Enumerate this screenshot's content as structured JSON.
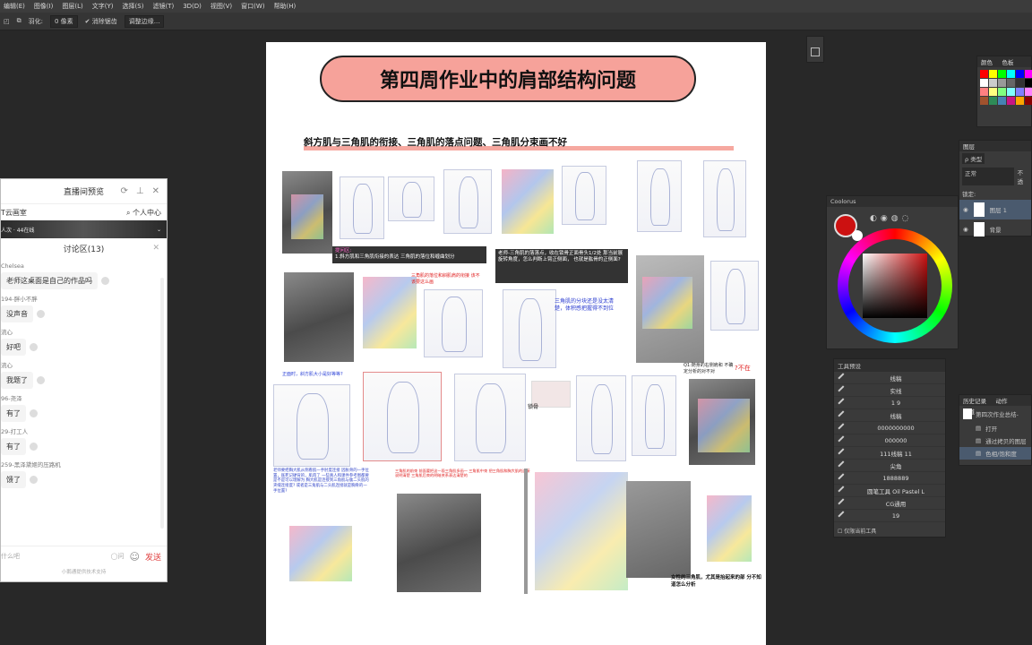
{
  "menu": [
    "编辑(E)",
    "图像(I)",
    "图层(L)",
    "文字(Y)",
    "选择(S)",
    "滤镜(T)",
    "3D(D)",
    "视图(V)",
    "窗口(W)",
    "帮助(H)"
  ],
  "options": {
    "feather_label": "羽化:",
    "feather_value": "0 像素",
    "antialias": "消除锯齿",
    "refine": "调整边缘..."
  },
  "document": {
    "title": "第四周作业中的肩部结构问题",
    "subtitle": "斜方肌与三角肌的衔接、三角肌的落点问题、三角肌分束画不好",
    "caption1": "1.斜方肌和三角肌衔接的表达 三角肌的落位和缠曲划分",
    "caption1_head": "提问区:",
    "caption2": "老师-三角肌的落落点，收在锁骨正面骨头1/2处 那当前展旋转角度，怎么判断上臂正侧面， 也就是肱骨的正侧面?",
    "blue_note": "三角肌的分块还是没太清楚，体积感把握得不到位",
    "red_note1": "三角肌的落位和斜肌肩的衔接 该不该要这么画",
    "red_note2": "正面时，斜方肌大小是好等等?",
    "q_note": "Q1:随身的右侧肩和 不确定分析的对不对",
    "q_mark": "?不在",
    "red_block": "老师要把胸大肌从侧看肌一手肘度连接 因胀骨的一手位置，既死记硬背的，肌肉了 一些真人和课件参考图都要是不是可以理解为 胸大肌是连接到三角肌与肱二头肌的夹缝连接度? 或者是三角肌与二头肌连接就是胸骨的一手位置?",
    "blue_block": "我帮我们描写了原先的需要和要描述的位置",
    "red_block2": "三角肌的前束 前面要把这一段三角肌多画一 三角肌中束 把三角肌和胸大肌的连接说明清楚 三角肌后束的明暗关系表达清楚的",
    "small_label": "锁骨",
    "bottom_note": "女性的三角肌，尤其是抬起来的部 分不知道怎么分析"
  },
  "live": {
    "title": "直播间预览",
    "channel": "T云画室",
    "personal": "个人中心",
    "stream_stats": "人次 · 44在线",
    "discussion": "讨论区(13)",
    "messages": [
      {
        "name": "Chelsea",
        "text": "老师这桌面是自己的作品吗"
      },
      {
        "name": "194-胖小不胖",
        "text": "没声音"
      },
      {
        "name": "流心",
        "text": "好吧"
      },
      {
        "name": "流心",
        "text": "我题了"
      },
      {
        "name": "96-尧泽",
        "text": "有了"
      },
      {
        "name": "29-打工人",
        "text": "有了"
      },
      {
        "name": "259-黑泽黛姬的压路机",
        "text": "馈了"
      }
    ],
    "input_placeholder": "什么吧",
    "send": "发送",
    "footer": "小鹅通提供技术支持"
  },
  "swatches_tabs": [
    "颜色",
    "色板"
  ],
  "swatch_colors": [
    "#ff0000",
    "#ffff00",
    "#00ff00",
    "#00ffff",
    "#0000ff",
    "#ff00ff",
    "#ffffff",
    "#cccccc",
    "#999999",
    "#666666",
    "#333333",
    "#000000",
    "#ff8080",
    "#ffff80",
    "#80ff80",
    "#80ffff",
    "#8080ff",
    "#ff80ff",
    "#a0522d",
    "#2e8b57",
    "#4682b4",
    "#c71585",
    "#ffa500",
    "#8b0000"
  ],
  "coolorus": {
    "title": "Coolorus",
    "hue_color": "#cc1111"
  },
  "layers": {
    "tab": "图层",
    "kind": "类型",
    "mode": "正常",
    "opacity_label": "不透",
    "lock_label": "锁定:",
    "items": [
      {
        "name": "图层 1"
      },
      {
        "name": "背景"
      }
    ]
  },
  "tool_presets": {
    "title": "工具预设",
    "items": [
      "线稿",
      "实线",
      "1  9",
      "线稿",
      "0000000000",
      "000000",
      "111线稿 11",
      "尖角",
      "1888889",
      "圆笔工具 Oil Pastel L",
      "CG通用",
      "19"
    ],
    "footer": "仅限当前工具"
  },
  "history": {
    "tabs": [
      "历史记录",
      "动作",
      "通道"
    ],
    "snapshot": "第四次作业总结-",
    "items": [
      "打开",
      "通过拷贝的图层",
      "色相/饱和度"
    ]
  }
}
